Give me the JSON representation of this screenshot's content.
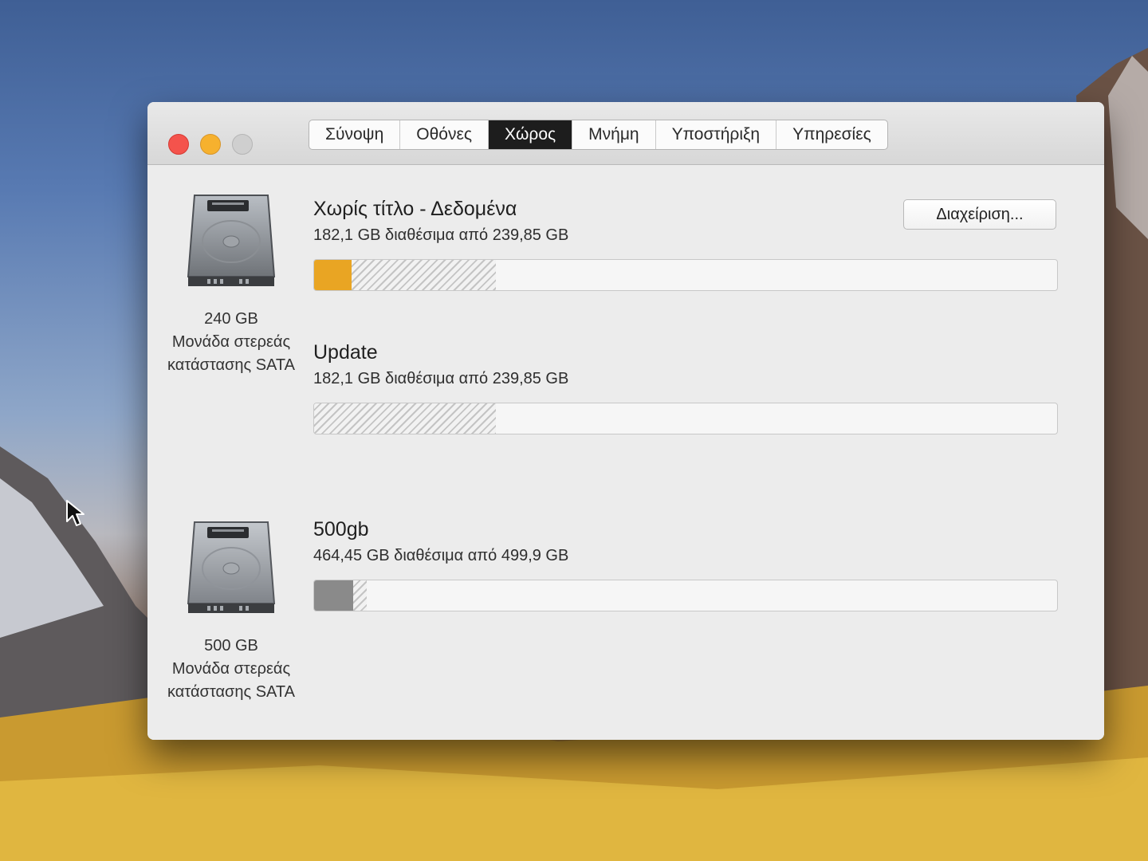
{
  "tabs": [
    {
      "label": "Σύνοψη",
      "active": false
    },
    {
      "label": "Οθόνες",
      "active": false
    },
    {
      "label": "Χώρος",
      "active": true
    },
    {
      "label": "Μνήμη",
      "active": false
    },
    {
      "label": "Υποστήριξη",
      "active": false
    },
    {
      "label": "Υπηρεσίες",
      "active": false
    }
  ],
  "manage_button": {
    "label": "Διαχείριση..."
  },
  "drives": [
    {
      "capacity": "240 GB",
      "type_line1": "Μονάδα στερεάς",
      "type_line2": "κατάστασης SATA",
      "icon": "hard-drive-icon"
    },
    {
      "capacity": "500 GB",
      "type_line1": "Μονάδα στερεάς",
      "type_line2": "κατάστασης SATA",
      "icon": "hard-drive-icon"
    }
  ],
  "volumes": [
    {
      "name": "Χωρίς τίτλο - Δεδομένα",
      "info": "182,1 GB διαθέσιμα από 239,85 GB",
      "used_fraction": 0.05,
      "purgeable_fraction": 0.195,
      "used_color": "#e9a523"
    },
    {
      "name": "Update",
      "info": "182,1 GB διαθέσιμα από 239,85 GB",
      "used_fraction": 0.0,
      "purgeable_fraction": 0.245,
      "used_color": "#e9a523"
    },
    {
      "name": "500gb",
      "info": "464,45 GB διαθέσιμα από 499,9 GB",
      "used_fraction": 0.053,
      "purgeable_fraction": 0.018,
      "used_color": "#8a8a8a"
    }
  ]
}
